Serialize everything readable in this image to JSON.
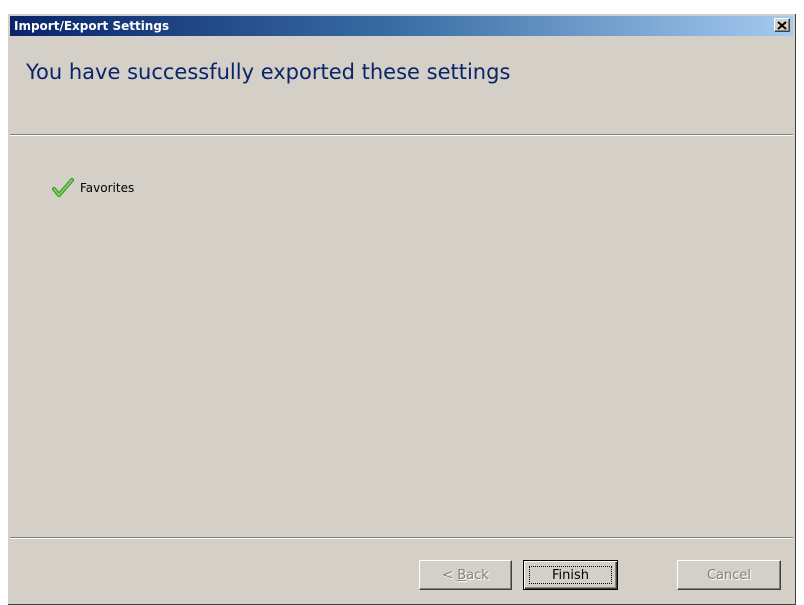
{
  "window": {
    "title": "Import/Export Settings",
    "close_glyph": "✕"
  },
  "header": {
    "heading": "You have successfully exported these settings"
  },
  "results": {
    "items": [
      {
        "label": "Favorites",
        "icon": "checkmark-icon",
        "status": "success"
      }
    ]
  },
  "buttons": {
    "back": {
      "prefix": "< ",
      "mnemonic": "B",
      "rest": "ack",
      "enabled": false
    },
    "finish": {
      "label": "Finish",
      "enabled": true
    },
    "cancel": {
      "label": "Cancel",
      "enabled": false
    }
  },
  "colors": {
    "heading": "#0a246a",
    "titlebar_start": "#0a246a",
    "titlebar_end": "#a6caf0",
    "dialog_face": "#d4d0c8",
    "check_green": "#4caf2a"
  }
}
